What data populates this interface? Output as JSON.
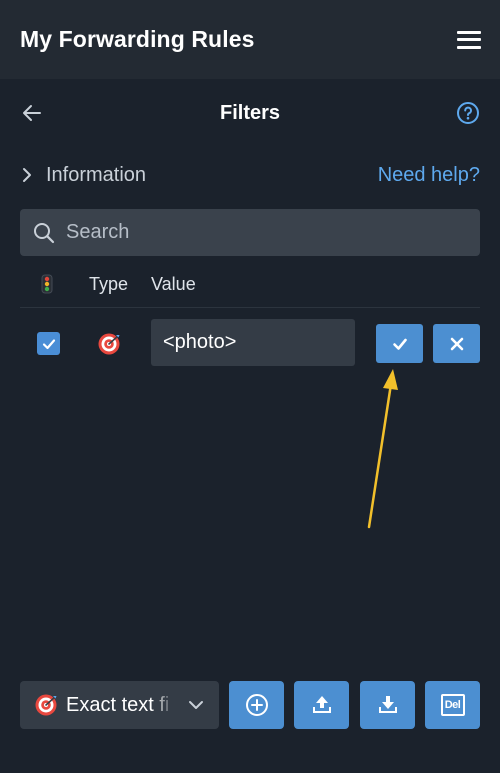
{
  "header": {
    "app_title": "My Forwarding Rules",
    "menu_icon": "hamburger-menu-icon"
  },
  "subheader": {
    "title": "Filters",
    "back_icon": "back-arrow-icon",
    "help_icon": "question-circle-icon"
  },
  "info": {
    "label": "Information",
    "help_link": "Need help?"
  },
  "search": {
    "placeholder": "Search",
    "value": ""
  },
  "table": {
    "columns": {
      "status_icon": "traffic-light-icon",
      "type": "Type",
      "value": "Value"
    },
    "rows": [
      {
        "checked": true,
        "type_icon": "target-icon",
        "value": "<photo>"
      }
    ]
  },
  "annotation": {
    "color": "#f2c02b"
  },
  "bottom": {
    "filter_type": "Exact text fi",
    "filter_type_icon": "target-icon",
    "tools": [
      "add-icon",
      "upload-icon",
      "download-icon"
    ],
    "delete_label": "Del"
  },
  "colors": {
    "background": "#1b222c",
    "appbar": "#232a33",
    "accent": "#4c8fd1",
    "link": "#5ea9ee"
  }
}
